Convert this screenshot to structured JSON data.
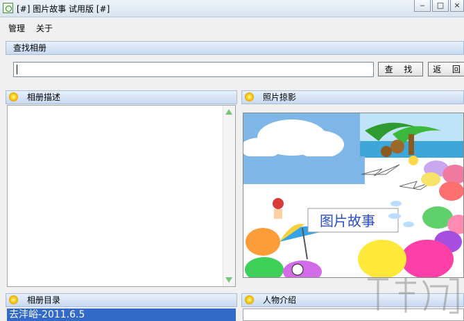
{
  "window": {
    "title": "[#] 图片故事 试用版 [#]",
    "minimize_icon": "minimize-icon",
    "maximize_icon": "maximize-icon",
    "close_icon": "close-icon"
  },
  "menu": {
    "items": [
      "管理",
      "关于"
    ]
  },
  "search_panel": {
    "title": "查找相册",
    "input_value": "",
    "search_button": "查 找",
    "back_button": "返 回"
  },
  "description_panel": {
    "title": "相册描述",
    "content": ""
  },
  "photo_panel": {
    "title": "照片掠影",
    "logo_text": "图片故事"
  },
  "directory_panel": {
    "title": "相册目录",
    "items": [
      "去沣峪-2011.6.5"
    ]
  },
  "person_panel": {
    "title": "人物介绍"
  },
  "colors": {
    "accent": "#3369c9",
    "header_bg": "#c8d9f0"
  }
}
